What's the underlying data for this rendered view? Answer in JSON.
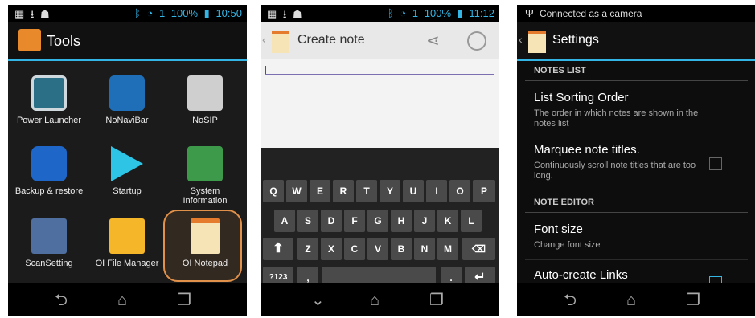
{
  "screen1": {
    "status": {
      "battery": "100%",
      "signal": "1",
      "time": "10:50"
    },
    "title": "Tools",
    "apps": [
      {
        "label": "Power Launcher",
        "icon": "power-launcher-icon"
      },
      {
        "label": "NoNaviBar",
        "icon": "nonavibar-icon"
      },
      {
        "label": "NoSIP",
        "icon": "nosip-keyboard-icon"
      },
      {
        "label": "Backup & restore",
        "icon": "backup-restore-icon"
      },
      {
        "label": "Startup",
        "icon": "startup-play-icon"
      },
      {
        "label": "System Information",
        "icon": "system-information-icon"
      },
      {
        "label": "ScanSetting",
        "icon": "scan-setting-icon"
      },
      {
        "label": "OI File Manager",
        "icon": "folder-icon"
      },
      {
        "label": "OI Notepad",
        "icon": "notepad-icon"
      }
    ],
    "highlight_color": "#e2914a"
  },
  "screen2": {
    "status": {
      "battery": "100%",
      "signal": "1",
      "time": "11:12"
    },
    "title": "Create note",
    "keys_row1": [
      "Q",
      "W",
      "E",
      "R",
      "T",
      "Y",
      "U",
      "I",
      "O",
      "P"
    ],
    "keys_row2": [
      "A",
      "S",
      "D",
      "F",
      "G",
      "H",
      "J",
      "K",
      "L"
    ],
    "keys_row3": [
      "Z",
      "X",
      "C",
      "V",
      "B",
      "N",
      "M"
    ],
    "key_symbols": "?123",
    "key_comma": ",",
    "key_period": "."
  },
  "screen3": {
    "status_text": "Connected as a camera",
    "title": "Settings",
    "section_notes_list": "NOTES LIST",
    "pref_sort_title": "List Sorting Order",
    "pref_sort_summary": "The order in which notes are shown in the notes list",
    "pref_marquee_title": "Marquee note titles.",
    "pref_marquee_summary": "Continuously scroll note titles that are too long.",
    "section_note_editor": "NOTE EDITOR",
    "pref_font_title": "Font size",
    "pref_font_summary": "Change font size",
    "pref_links_title": "Auto-create Links",
    "accent_color": "#33b5e5"
  }
}
